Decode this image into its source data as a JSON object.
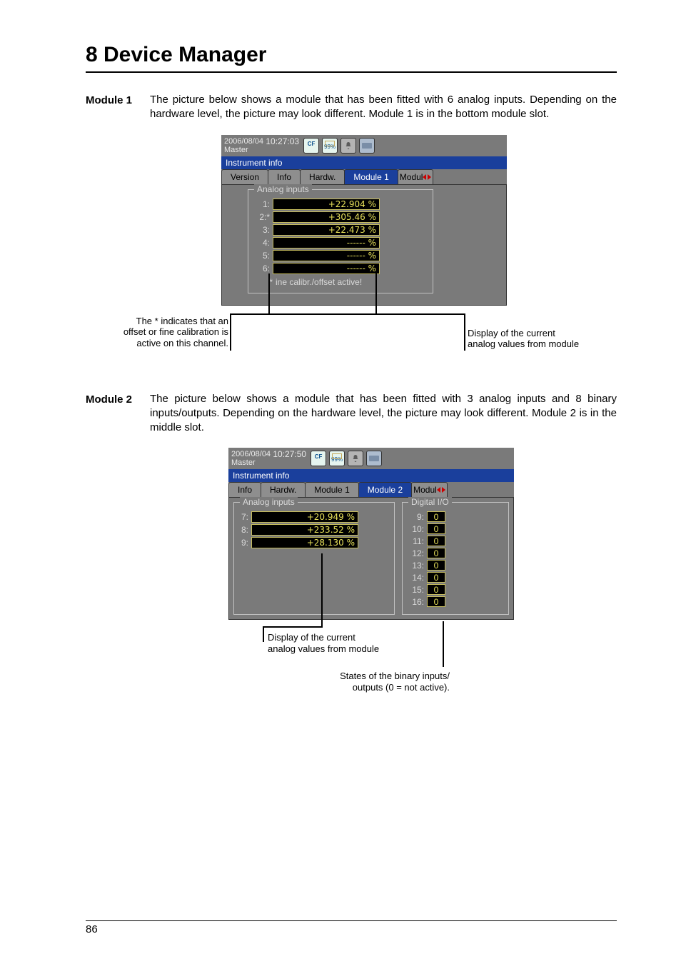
{
  "chapter_title": "8 Device Manager",
  "page_number": "86",
  "module1": {
    "side_label": "Module 1",
    "paragraph": "The picture below shows a module that has been fitted with 6 analog inputs. Depending on the hardware level, the picture may look different. Module 1 is in the bottom module slot.",
    "topbar": {
      "date": "2006/08/04",
      "time": "10:27:03",
      "master": "Master",
      "pct": "99%"
    },
    "bluebar": "Instrument info",
    "tabs": {
      "t1": "Version",
      "t2": "Info",
      "t3": "Hardw.",
      "active": "Module 1",
      "scroll_label": "Modul "
    },
    "group_title": "Analog inputs",
    "analog": {
      "r1": {
        "label": "1:",
        "value": "+22.904 %"
      },
      "r2": {
        "label": "2:*",
        "value": "+305.46 %"
      },
      "r3": {
        "label": "3:",
        "value": "+22.473 %"
      },
      "r4": {
        "label": "4:",
        "value": "------ %"
      },
      "r5": {
        "label": "5:",
        "value": "------ %"
      },
      "r6": {
        "label": "6:",
        "value": "------ %"
      }
    },
    "note_star": "*",
    "note_text": "ine calibr./offset active!",
    "callout_left_l1": "The * indicates that an",
    "callout_left_l2": "offset or fine calibration is",
    "callout_left_l3": "active on this channel.",
    "callout_right_l1": "Display of the current",
    "callout_right_l2": "analog values from module"
  },
  "module2": {
    "side_label": "Module 2",
    "paragraph": "The picture below shows a module that has been fitted with 3 analog inputs and 8 binary inputs/outputs. Depending on the hardware level, the picture may look different. Module 2 is in the middle slot.",
    "topbar": {
      "date": "2006/08/04",
      "time": "10:27:50",
      "master": "Master",
      "pct": "99%"
    },
    "bluebar": "Instrument info",
    "tabs": {
      "t1": "Info",
      "t2": "Hardw.",
      "t3": "Module 1",
      "active": "Module 2",
      "scroll_label": "Modul "
    },
    "group_ai_title": "Analog inputs",
    "group_dio_title": "Digital I/O",
    "analog": {
      "r7": {
        "label": "7:",
        "value": "+20.949 %"
      },
      "r8": {
        "label": "8:",
        "value": "+233.52 %"
      },
      "r9": {
        "label": "9:",
        "value": "+28.130 %"
      }
    },
    "dio": {
      "d9": {
        "label": "9:",
        "value": "0"
      },
      "d10": {
        "label": "10:",
        "value": "0"
      },
      "d11": {
        "label": "11:",
        "value": "0"
      },
      "d12": {
        "label": "12:",
        "value": "0"
      },
      "d13": {
        "label": "13:",
        "value": "0"
      },
      "d14": {
        "label": "14:",
        "value": "0"
      },
      "d15": {
        "label": "15:",
        "value": "0"
      },
      "d16": {
        "label": "16:",
        "value": "0"
      }
    },
    "callout_ai_l1": "Display of the current",
    "callout_ai_l2": "analog values from module",
    "callout_dio_l1": "States of the binary inputs/",
    "callout_dio_l2": "outputs (0 = not active)."
  }
}
